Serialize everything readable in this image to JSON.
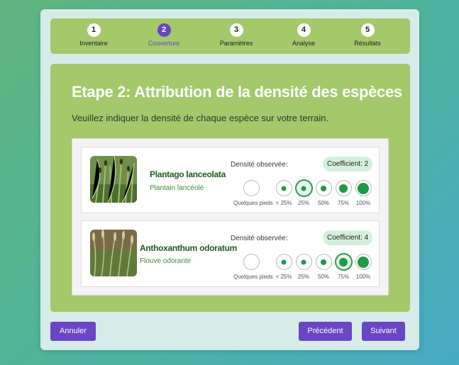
{
  "stepper": {
    "steps": [
      {
        "num": "1",
        "label": "Inventaire"
      },
      {
        "num": "2",
        "label": "Couverture"
      },
      {
        "num": "3",
        "label": "Paramètres"
      },
      {
        "num": "4",
        "label": "Analyse"
      },
      {
        "num": "5",
        "label": "Résultats"
      }
    ],
    "active_step": 2
  },
  "main": {
    "title": "Etape 2: Attribution de la densité des espèces",
    "subtitle": "Veuillez indiquer la densité de chaque espèce sur votre terrain.",
    "density_label": "Densité observée:",
    "density_options": [
      "Quelques pieds",
      "< 25%",
      "25%",
      "50%",
      "75%",
      "100%"
    ],
    "species": [
      {
        "scientific_name": "Plantago lanceolata",
        "common_name": "Plantain lancéolé",
        "coefficient": "Coefficient: 2",
        "selected_option": "25%"
      },
      {
        "scientific_name": "Anthoxanthum odoratum",
        "common_name": "Flouve odorante",
        "coefficient": "Coefficient: 4",
        "selected_option": "75%"
      }
    ]
  },
  "footer": {
    "cancel_label": "Annuler",
    "previous_label": "Précédent",
    "next_label": "Suivant"
  },
  "colors": {
    "accent": "#6a45c4",
    "panel": "#a3c96a",
    "density_dot": "#1f9847"
  }
}
